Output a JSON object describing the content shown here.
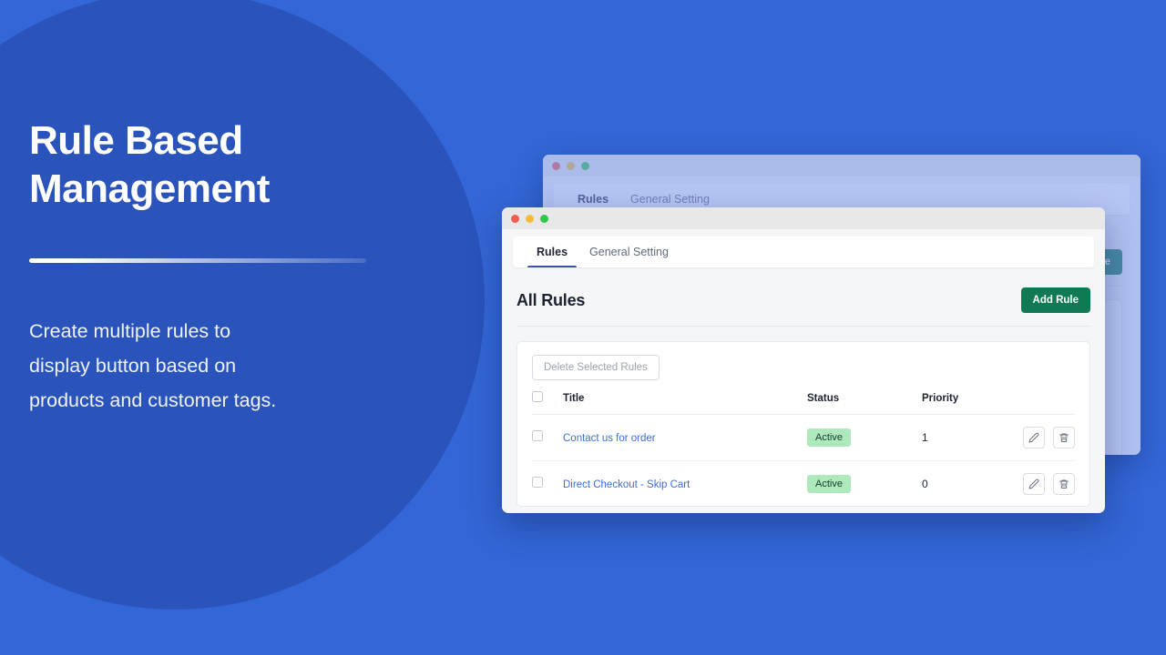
{
  "hero": {
    "title": "Rule Based\nManagement",
    "subtitle": "Create multiple rules to\ndisplay button based on\nproducts and customer tags.",
    "bg_outer_color": "#3366D6",
    "bg_circle_color": "#2A54BC"
  },
  "back_window": {
    "tabs": [
      {
        "label": "Rules",
        "active": true
      },
      {
        "label": "General Setting",
        "active": false
      }
    ],
    "page_title": "All Rules",
    "add_button_label": "Add Rule"
  },
  "front_window": {
    "tabs": [
      {
        "label": "Rules",
        "active": true
      },
      {
        "label": "General Setting",
        "active": false
      }
    ],
    "page_title": "All Rules",
    "add_button_label": "Add Rule",
    "accent_color": "#107A54",
    "delete_selected_label": "Delete Selected Rules",
    "table": {
      "columns": [
        "Title",
        "Status",
        "Priority"
      ],
      "rows": [
        {
          "title": "Contact us for order",
          "status": "Active",
          "priority": "1",
          "status_color": "#AEE9BE"
        },
        {
          "title": "Direct Checkout - Skip Cart",
          "status": "Active",
          "priority": "0",
          "status_color": "#AEE9BE"
        }
      ]
    }
  }
}
